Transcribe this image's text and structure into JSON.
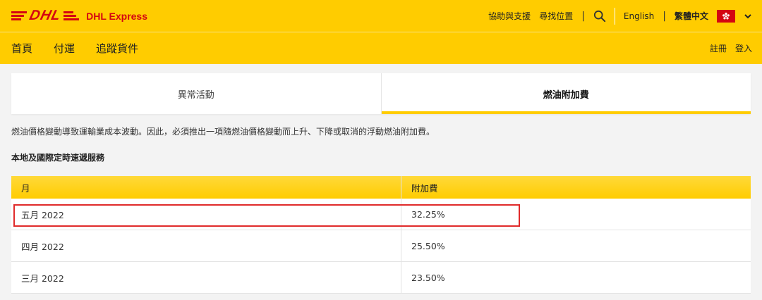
{
  "header": {
    "logo_text": "DHL",
    "brand_name": "DHL Express",
    "utility_links": [
      "協助與支援",
      "尋找位置"
    ],
    "lang_english": "English",
    "lang_chinese": "繁體中文",
    "icons": {
      "search": "search-icon",
      "flag": "hk-flag-icon",
      "dropdown": "chevron-down-icon"
    },
    "colors": {
      "brand_yellow": "#ffcc00",
      "brand_red": "#d40511"
    }
  },
  "nav": {
    "items": [
      "首頁",
      "付運",
      "追蹤貨件"
    ],
    "register": "註冊",
    "login": "登入"
  },
  "tabs": [
    {
      "label": "異常活動",
      "active": false
    },
    {
      "label": "燃油附加費",
      "active": true
    }
  ],
  "content": {
    "description": "燃油價格變動導致運輸業成本波動。因此，必須推出一項隨燃油價格變動而上升、下降或取消的浮動燃油附加費。",
    "section_title": "本地及國際定時速遞服務"
  },
  "table": {
    "headers": [
      "月",
      "附加費"
    ],
    "rows": [
      [
        "五月 2022",
        "32.25%"
      ],
      [
        "四月 2022",
        "25.50%"
      ],
      [
        "三月 2022",
        "23.50%"
      ]
    ],
    "highlight_color": "#e02b2b"
  }
}
